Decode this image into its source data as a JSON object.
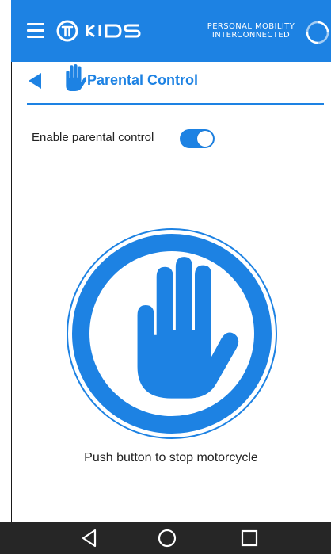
{
  "app": {
    "brand_tagline_line1": "PERSONAL MOBILITY",
    "brand_tagline_line2": "INTERCONNECTED",
    "accent_color": "#1d82e3"
  },
  "icons": {
    "menu": "hamburger-menu-icon",
    "logo": "kids-logo",
    "sync": "sync-icon",
    "back": "back-arrow-icon",
    "hand": "hand-stop-icon",
    "nav_back": "triangle-back-icon",
    "nav_home": "circle-home-icon",
    "nav_recent": "square-recents-icon"
  },
  "header": {
    "title": "Parental Control"
  },
  "settings": {
    "enable_label": "Enable parental control",
    "enabled": true
  },
  "stop": {
    "caption": "Push button to stop motorcycle"
  }
}
